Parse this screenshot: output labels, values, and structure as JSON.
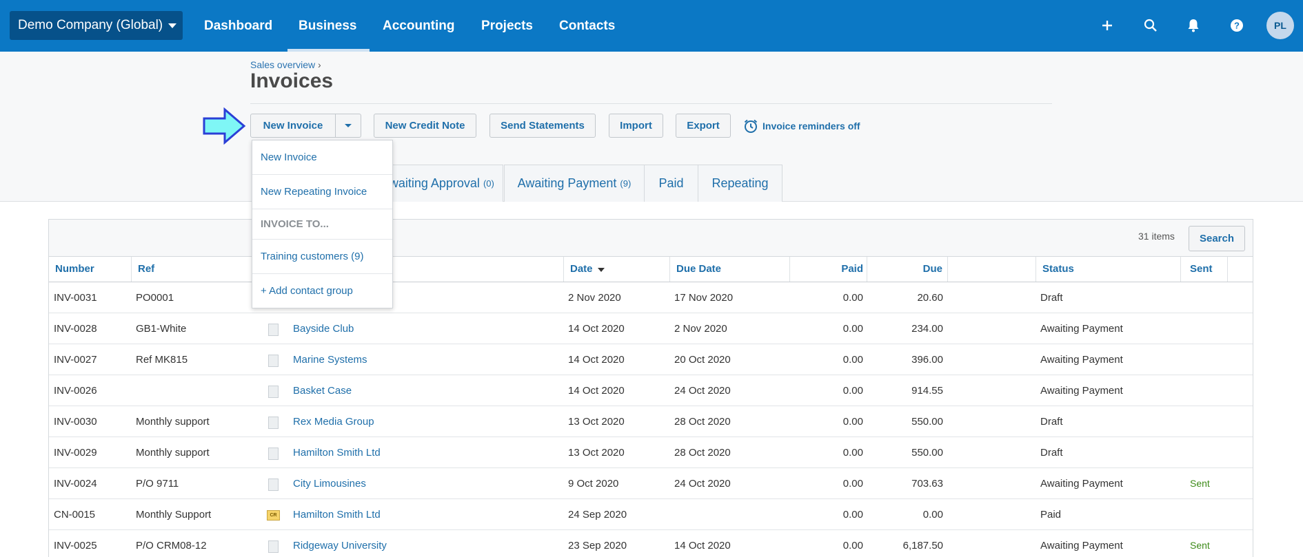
{
  "topbar": {
    "org_name": "Demo Company (Global)",
    "nav": [
      "Dashboard",
      "Business",
      "Accounting",
      "Projects",
      "Contacts"
    ],
    "active_nav": "Business",
    "avatar_initials": "PL",
    "icons": [
      "plus-icon",
      "search-icon",
      "bell-icon",
      "help-icon"
    ]
  },
  "page": {
    "breadcrumb": "Sales overview",
    "breadcrumb_sep": "›",
    "title": "Invoices"
  },
  "toolbar": {
    "new_invoice": "New Invoice",
    "new_credit_note": "New Credit Note",
    "send_statements": "Send Statements",
    "import": "Import",
    "export": "Export",
    "reminders": "Invoice reminders off"
  },
  "dropdown": {
    "items": [
      "New Invoice",
      "New Repeating Invoice",
      "INVOICE TO...",
      "Training customers (9)",
      "+ Add contact group"
    ]
  },
  "tabs": [
    {
      "label": "Awaiting Approval",
      "count": "(0)"
    },
    {
      "label": "Awaiting Payment",
      "count": "(9)"
    },
    {
      "label": "Paid",
      "count": ""
    },
    {
      "label": "Repeating",
      "count": ""
    }
  ],
  "table": {
    "items_count": "31 items",
    "search_label": "Search",
    "columns": {
      "number": "Number",
      "ref": "Ref",
      "date": "Date",
      "due_date": "Due Date",
      "paid": "Paid",
      "due": "Due",
      "status": "Status",
      "sent": "Sent"
    },
    "rows": [
      {
        "number": "INV-0031",
        "ref": "PO0001",
        "icon": "doc",
        "to": "",
        "date": "2 Nov 2020",
        "due_date": "17 Nov 2020",
        "paid": "0.00",
        "due": "20.60",
        "status": "Draft",
        "sent": ""
      },
      {
        "number": "INV-0028",
        "ref": "GB1-White",
        "icon": "doc",
        "to": "Bayside Club",
        "date": "14 Oct 2020",
        "due_date": "2 Nov 2020",
        "paid": "0.00",
        "due": "234.00",
        "status": "Awaiting Payment",
        "sent": ""
      },
      {
        "number": "INV-0027",
        "ref": "Ref MK815",
        "icon": "doc",
        "to": "Marine Systems",
        "date": "14 Oct 2020",
        "due_date": "20 Oct 2020",
        "paid": "0.00",
        "due": "396.00",
        "status": "Awaiting Payment",
        "sent": ""
      },
      {
        "number": "INV-0026",
        "ref": "",
        "icon": "doc",
        "to": "Basket Case",
        "date": "14 Oct 2020",
        "due_date": "24 Oct 2020",
        "paid": "0.00",
        "due": "914.55",
        "status": "Awaiting Payment",
        "sent": ""
      },
      {
        "number": "INV-0030",
        "ref": "Monthly support",
        "icon": "doc",
        "to": "Rex Media Group",
        "date": "13 Oct 2020",
        "due_date": "28 Oct 2020",
        "paid": "0.00",
        "due": "550.00",
        "status": "Draft",
        "sent": ""
      },
      {
        "number": "INV-0029",
        "ref": "Monthly support",
        "icon": "doc",
        "to": "Hamilton Smith Ltd",
        "date": "13 Oct 2020",
        "due_date": "28 Oct 2020",
        "paid": "0.00",
        "due": "550.00",
        "status": "Draft",
        "sent": ""
      },
      {
        "number": "INV-0024",
        "ref": "P/O 9711",
        "icon": "doc",
        "to": "City Limousines",
        "date": "9 Oct 2020",
        "due_date": "24 Oct 2020",
        "paid": "0.00",
        "due": "703.63",
        "status": "Awaiting Payment",
        "sent": "Sent"
      },
      {
        "number": "CN-0015",
        "ref": "Monthly Support",
        "icon": "cr",
        "to": "Hamilton Smith Ltd",
        "date": "24 Sep 2020",
        "due_date": "",
        "paid": "0.00",
        "due": "0.00",
        "status": "Paid",
        "sent": ""
      },
      {
        "number": "INV-0025",
        "ref": "P/O CRM08-12",
        "icon": "doc",
        "to": "Ridgeway University",
        "date": "23 Sep 2020",
        "due_date": "14 Oct 2020",
        "paid": "0.00",
        "due": "6,187.50",
        "status": "Awaiting Payment",
        "sent": "Sent"
      }
    ]
  },
  "colors": {
    "nav_blue": "#0b78c5",
    "org_button": "#06518a",
    "link_blue": "#1f6faa",
    "sent_green": "#3d8b19",
    "arrow_fill": "#7ff6f6",
    "arrow_stroke": "#2b3fd6"
  }
}
